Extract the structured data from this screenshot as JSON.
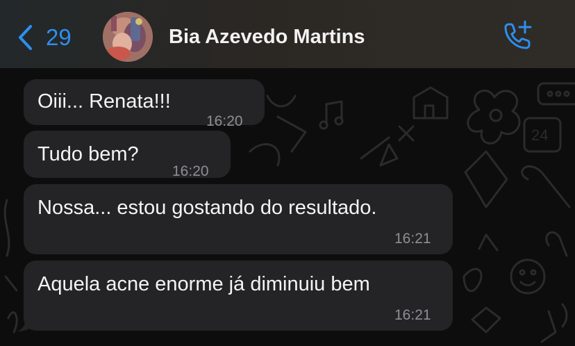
{
  "header": {
    "back_count": "29",
    "contact_name": "Bia Azevedo Martins"
  },
  "messages": [
    {
      "text": "Oiii... Renata!!!",
      "time": "16:20"
    },
    {
      "text": "Tudo bem?",
      "time": "16:20"
    },
    {
      "text": "Nossa... estou gostando do resultado.",
      "time": "16:21"
    },
    {
      "text": "Aquela acne enorme já diminuiu bem",
      "time": "16:21"
    }
  ],
  "icons": {
    "back": "chevron-left-icon",
    "call": "phone-add-icon"
  },
  "colors": {
    "accent": "#2c8ff0",
    "bubble": "#242426",
    "background": "#0d0d0d",
    "timestamp": "#8e8e93"
  }
}
